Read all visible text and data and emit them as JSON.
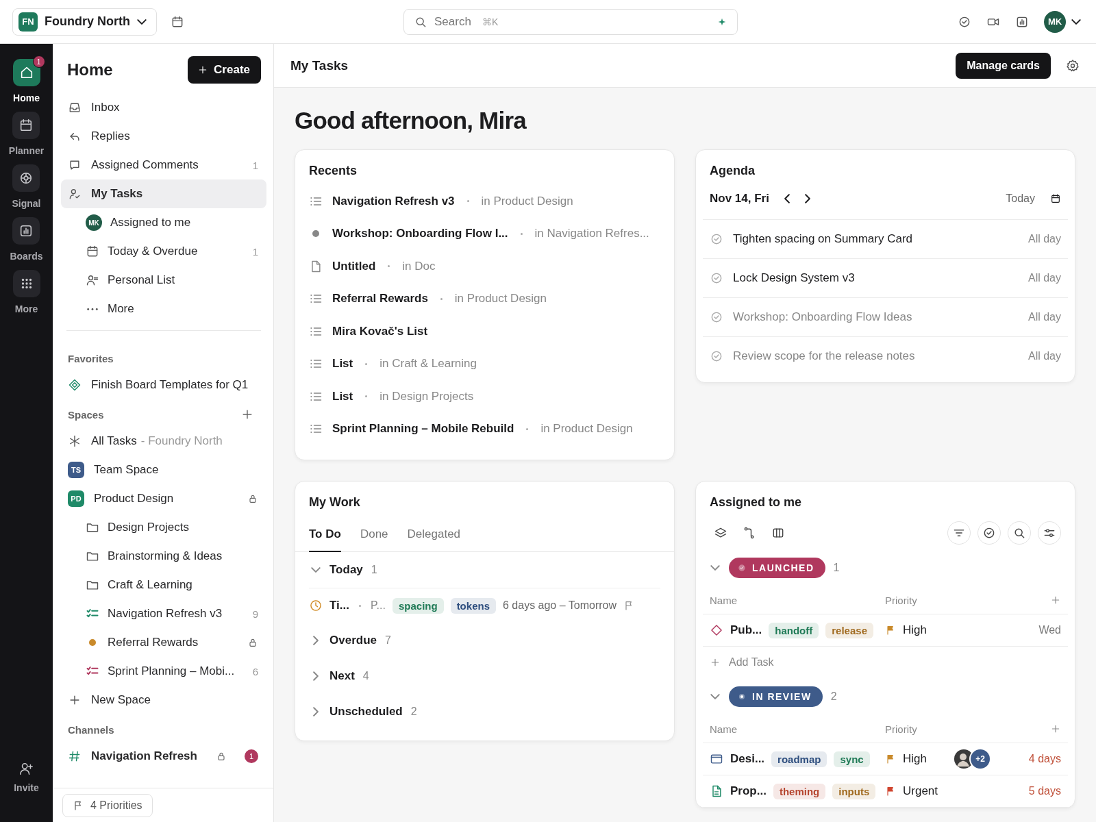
{
  "topbar": {
    "workspace": {
      "initials": "FN",
      "name": "Foundry North"
    },
    "search": {
      "placeholder": "Search",
      "shortcut": "⌘K"
    },
    "user": {
      "initials": "MK"
    }
  },
  "rail": {
    "items": [
      {
        "kind": "home",
        "label": "Home",
        "selected": true,
        "badge": "1"
      },
      {
        "kind": "calendar",
        "label": "Planner",
        "selected": false
      },
      {
        "kind": "target",
        "label": "Signal",
        "selected": false
      },
      {
        "kind": "chart",
        "label": "Boards",
        "selected": false
      },
      {
        "kind": "grid",
        "label": "More",
        "selected": false
      }
    ],
    "invite": "Invite"
  },
  "sidebar": {
    "title": "Home",
    "create": "Create",
    "nav": [
      {
        "kind": "inbox",
        "label": "Inbox",
        "selected": false
      },
      {
        "kind": "reply",
        "label": "Replies",
        "selected": false
      },
      {
        "kind": "comment",
        "label": "Assigned Comments",
        "count": "1",
        "selected": false
      },
      {
        "kind": "user-check",
        "label": "My Tasks",
        "selected": true,
        "children": [
          {
            "kind": "avatar",
            "label": "Assigned to me",
            "initials": "MK",
            "selected": false
          },
          {
            "kind": "calendar",
            "label": "Today & Overdue",
            "count": "1",
            "selected": false
          },
          {
            "kind": "user-list",
            "label": "Personal List",
            "selected": false
          },
          {
            "kind": "dots",
            "label": "More",
            "selected": false
          }
        ]
      }
    ],
    "favorites": {
      "heading": "Favorites",
      "items": [
        {
          "kind": "diamond",
          "label": "Finish Board Templates for Q1",
          "selected": false
        }
      ]
    },
    "spaces": {
      "heading": "Spaces",
      "items": [
        {
          "kind": "asterisk",
          "label": "All Tasks",
          "suffix": "- Foundry North",
          "locked": false
        },
        {
          "kind": "space",
          "initials": "TS",
          "color": "#3e5b8a",
          "label": "Team Space",
          "locked": false
        },
        {
          "kind": "space",
          "initials": "PD",
          "color": "#1f8a68",
          "label": "Product Design",
          "locked": true,
          "children": [
            {
              "kind": "folder",
              "label": "Design Projects",
              "locked": false
            },
            {
              "kind": "folder",
              "label": "Brainstorming & Ideas",
              "locked": false
            },
            {
              "kind": "folder",
              "label": "Craft & Learning",
              "locked": false
            },
            {
              "kind": "list",
              "label": "Navigation Refresh v3",
              "count": "9",
              "color": "#1f8a68",
              "locked": false
            },
            {
              "kind": "dot",
              "label": "Referral Rewards",
              "color": "#c98a2b",
              "locked": true
            },
            {
              "kind": "list",
              "label": "Sprint Planning – Mobi...",
              "count": "6",
              "color": "#b0385e",
              "locked": false
            }
          ]
        }
      ],
      "new_space": "New Space"
    },
    "channels": {
      "heading": "Channels",
      "items": [
        {
          "label": "Navigation Refresh",
          "locked": true,
          "badge": "1"
        }
      ]
    },
    "footer": {
      "label": "4 Priorities"
    }
  },
  "main": {
    "title": "My Tasks",
    "manage": "Manage cards",
    "greeting": "Good afternoon, Mira",
    "recents": {
      "title": "Recents",
      "items": [
        {
          "kind": "list",
          "name": "Navigation Refresh v3",
          "location": "in Product Design"
        },
        {
          "kind": "task",
          "name": "Workshop: Onboarding Flow I...",
          "location": "in Navigation Refres..."
        },
        {
          "kind": "doc",
          "name": "Untitled",
          "location": "in Doc"
        },
        {
          "kind": "list",
          "name": "Referral Rewards",
          "location": "in Product Design"
        },
        {
          "kind": "list",
          "name": "Mira Kovač's List"
        },
        {
          "kind": "list",
          "name": "List",
          "location": "in Craft & Learning"
        },
        {
          "kind": "list",
          "name": "List",
          "location": "in Design Projects"
        },
        {
          "kind": "list",
          "name": "Sprint Planning – Mobile Rebuild",
          "location": "in Product Design"
        }
      ]
    },
    "agenda": {
      "title": "Agenda",
      "date": "Nov 14, Fri",
      "today": "Today",
      "items": [
        {
          "title": "Tighten spacing on Summary Card",
          "time": "All day",
          "dimmed": false
        },
        {
          "title": "Lock Design System v3",
          "time": "All day",
          "dimmed": false
        },
        {
          "title": "Workshop: Onboarding Flow Ideas",
          "time": "All day",
          "dimmed": true
        },
        {
          "title": "Review scope for the release notes",
          "time": "All day",
          "dimmed": true
        }
      ]
    },
    "my_work": {
      "title": "My Work",
      "tabs": [
        {
          "label": "To Do",
          "selected": true
        },
        {
          "label": "Done",
          "selected": false
        },
        {
          "label": "Delegated",
          "selected": false
        }
      ],
      "groups": [
        {
          "label": "Today",
          "count": "1",
          "expanded": true,
          "tasks": [
            {
              "name": "Ti...",
              "location": "P...",
              "tags": [
                {
                  "label": "spacing",
                  "color": "#1f7a56"
                },
                {
                  "label": "tokens",
                  "color": "#2f4f7f"
                }
              ],
              "dates": "6 days ago – Tomorrow"
            }
          ]
        },
        {
          "label": "Overdue",
          "count": "7",
          "expanded": false
        },
        {
          "label": "Next",
          "count": "4",
          "expanded": false
        },
        {
          "label": "Unscheduled",
          "count": "2",
          "expanded": false
        }
      ]
    },
    "assigned": {
      "title": "Assigned to me",
      "groups": [
        {
          "status": "LAUNCHED",
          "kind": "done",
          "color": "#b0385e",
          "count": "1",
          "expanded": true,
          "columns": [
            "Name",
            "Priority"
          ],
          "tasks": [
            {
              "kind": "milestone",
              "name": "Pub...",
              "tags": [
                {
                  "label": "handoff",
                  "color": "#1f7a56"
                },
                {
                  "label": "release",
                  "color": "#a06a1f"
                }
              ],
              "priority": "High",
              "color": "#c98a2b",
              "due": "Wed",
              "overdue": false
            }
          ],
          "add_task": "Add Task"
        },
        {
          "status": "IN REVIEW",
          "kind": "active",
          "color": "#3e5b8a",
          "count": "2",
          "expanded": true,
          "columns": [
            "Name",
            "Priority"
          ],
          "tasks": [
            {
              "kind": "card",
              "name": "Desi...",
              "tags": [
                {
                  "label": "roadmap",
                  "color": "#2f4f7f"
                },
                {
                  "label": "sync",
                  "color": "#1f7a56"
                }
              ],
              "priority": "High",
              "color": "#c98a2b",
              "assignees": {
                "photo": true,
                "more": "+2"
              },
              "due": "4 days",
              "overdue": true
            },
            {
              "kind": "doc",
              "name": "Prop...",
              "tags": [
                {
                  "label": "theming",
                  "color": "#b5452f"
                },
                {
                  "label": "inputs",
                  "color": "#a06a1f"
                }
              ],
              "priority": "Urgent",
              "color": "#d0452f",
              "due": "5 days",
              "overdue": true
            }
          ]
        }
      ]
    }
  }
}
